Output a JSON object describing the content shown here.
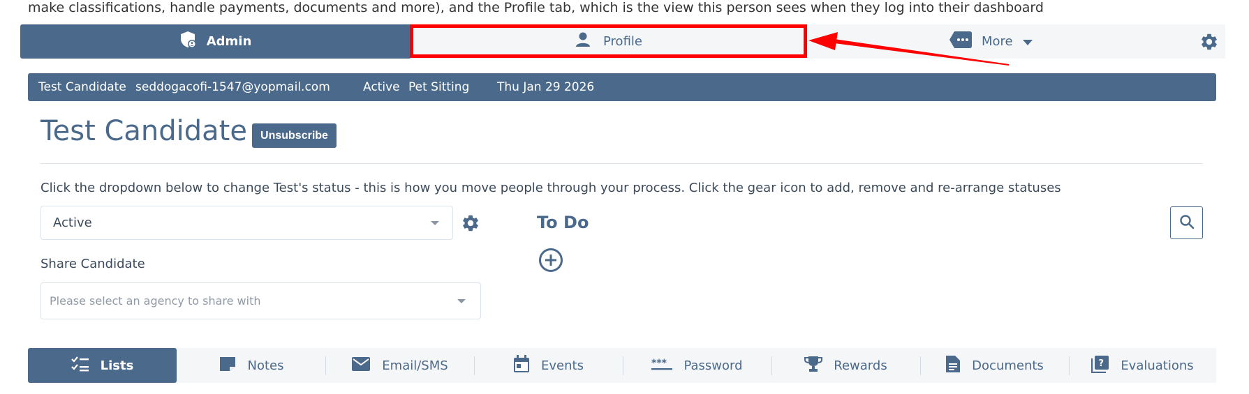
{
  "intro_text": "make classifications, handle payments, documents and more), and the Profile tab, which is the view this person sees when they log into their dashboard",
  "top_tabs": {
    "admin": "Admin",
    "profile": "Profile",
    "more": "More"
  },
  "info": {
    "name": "Test Candidate",
    "email": "seddogacofi-1547@yopmail.com",
    "status": "Active",
    "category": "Pet Sitting",
    "date": "Thu Jan 29 2026"
  },
  "candidate": {
    "title": "Test Candidate",
    "unsubscribe_label": "Unsubscribe"
  },
  "instruction": "Click the dropdown below to change Test's status - this is how you move people through your process. Click the gear icon to add, remove and re-arrange statuses",
  "status_select": {
    "value": "Active"
  },
  "share": {
    "label": "Share Candidate",
    "placeholder": "Please select an agency to share with"
  },
  "todo": {
    "title": "To Do"
  },
  "bottom_tabs": [
    {
      "label": "Lists",
      "icon": "checklist-icon"
    },
    {
      "label": "Notes",
      "icon": "note-icon"
    },
    {
      "label": "Email/SMS",
      "icon": "envelope-icon"
    },
    {
      "label": "Events",
      "icon": "calendar-icon"
    },
    {
      "label": "Password",
      "icon": "password-icon"
    },
    {
      "label": "Rewards",
      "icon": "trophy-icon"
    },
    {
      "label": "Documents",
      "icon": "document-icon"
    },
    {
      "label": "Evaluations",
      "icon": "evaluation-icon"
    }
  ],
  "colors": {
    "primary": "#4b6a8b",
    "highlight": "#ff0000",
    "bar_background": "#f4f6f8"
  }
}
